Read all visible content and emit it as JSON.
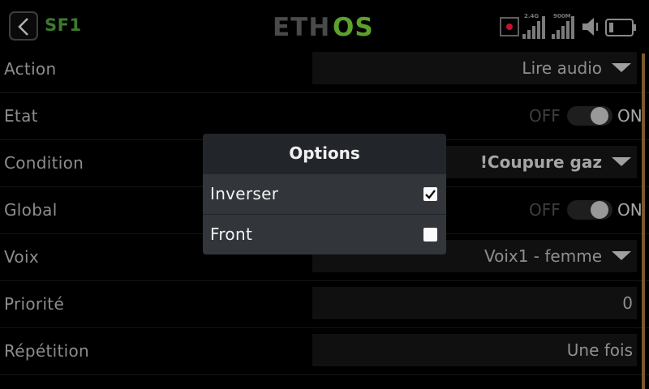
{
  "header": {
    "title": "SF1",
    "logo": {
      "left": "ETH",
      "right": "OS"
    },
    "signals": [
      {
        "label": "2.4G"
      },
      {
        "label": "900M"
      }
    ]
  },
  "rows": [
    {
      "label": "Action",
      "value": "Lire audio"
    },
    {
      "label": "Etat",
      "off_label": "OFF",
      "on_label": "ON"
    },
    {
      "label": "Condition",
      "value": "!Coupure gaz"
    },
    {
      "label": "Global",
      "off_label": "OFF",
      "on_label": "ON"
    },
    {
      "label": "Voix",
      "value": "Voix1 - femme"
    },
    {
      "label": "Priorité",
      "value": "0"
    },
    {
      "label": "Répétition",
      "value": "Une fois"
    }
  ],
  "dialog": {
    "title": "Options",
    "options": [
      {
        "label": "Inverser",
        "checked": true
      },
      {
        "label": "Front",
        "checked": false
      }
    ]
  },
  "colors": {
    "accent": "#3c7a2c",
    "logo_green": "#5ca12e",
    "record": "#c8102e"
  },
  "icons": [
    "back-arrow-icon",
    "record-icon",
    "signal-icon",
    "speaker-icon",
    "battery-icon",
    "dropdown-caret-icon",
    "checkbox-icon"
  ]
}
